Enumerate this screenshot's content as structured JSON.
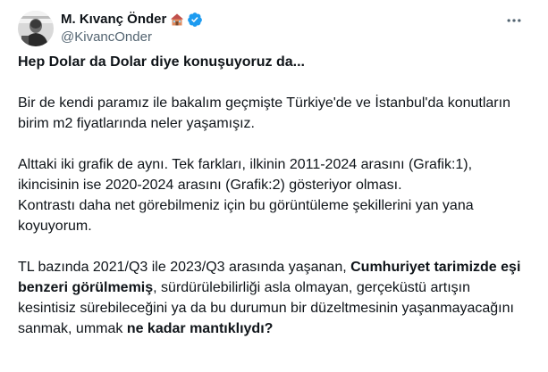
{
  "author": {
    "display_name": "M. Kıvanç Önder",
    "handle": "@KivancOnder",
    "badge_emoji": "house-emoji",
    "verified": true,
    "verified_color": "#1d9bf0"
  },
  "menu": {
    "icon": "more-horizontal-icon"
  },
  "tweet": {
    "headline": "Hep Dolar da Dolar diye konuşuyoruz da...",
    "p1": "Bir de kendi paramız ile bakalım geçmişte Türkiye'de ve İstanbul'da konutların birim m2 fiyatlarında neler yaşamışız.",
    "p2_line1": "Alttaki iki grafik de aynı. Tek farkları, ilkinin 2011-2024 arasını (Grafik:1), ikincisinin ise 2020-2024 arasını (Grafik:2) gösteriyor olması.",
    "p2_line2": "Kontrastı daha net görebilmeniz için bu görüntüleme şekillerini yan yana koyuyorum.",
    "p3_part1": "TL bazında 2021/Q3 ile 2023/Q3 arasında yaşanan, ",
    "p3_bold1": "Cumhuriyet tarimizde eşi benzeri görülmemiş",
    "p3_part2": ", sürdürülebilirliği asla olmayan, gerçeküstü artışın kesintisiz sürebileceğini ya da bu durumun bir düzeltmesinin yaşanmayacağını sanmak, ummak ",
    "p3_bold2": "ne kadar mantıklıydı?"
  },
  "colors": {
    "text": "#0f1419",
    "secondary": "#536471",
    "accent": "#1d9bf0"
  }
}
